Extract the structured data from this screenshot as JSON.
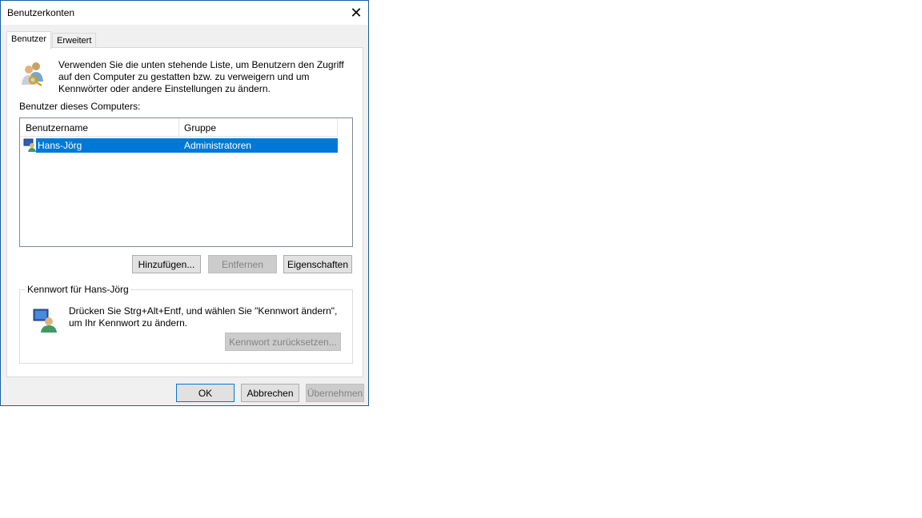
{
  "window": {
    "title": "Benutzerkonten",
    "close_glyph": "✕"
  },
  "tabs": [
    {
      "label": "Benutzer",
      "active": true
    },
    {
      "label": "Erweitert",
      "active": false
    }
  ],
  "intro_text": "Verwenden Sie die unten stehende Liste, um Benutzern den Zugriff auf den Computer zu gestatten bzw. zu verweigern und um Kennwörter oder andere Einstellungen zu ändern.",
  "users_list": {
    "label": "Benutzer dieses Computers:",
    "columns": [
      "Benutzername",
      "Gruppe"
    ],
    "rows": [
      {
        "name": "Hans-Jörg",
        "group": "Administratoren",
        "selected": true
      }
    ]
  },
  "list_buttons": {
    "add": "Hinzufügen...",
    "remove": "Entfernen",
    "properties": "Eigenschaften"
  },
  "password_group": {
    "title": "Kennwort für Hans-Jörg",
    "text": "Drücken Sie Strg+Alt+Entf, und wählen Sie \"Kennwort ändern\", um Ihr Kennwort zu ändern.",
    "reset_button": "Kennwort zurücksetzen..."
  },
  "dialog_buttons": {
    "ok": "OK",
    "cancel": "Abbrechen",
    "apply": "Übernehmen"
  },
  "colors": {
    "selection": "#0078d7",
    "window_border": "#1b5d9c"
  },
  "icons": {
    "users": "users-key-icon",
    "row_user": "user-computer-icon",
    "password": "user-computer-icon",
    "close": "close-icon"
  }
}
